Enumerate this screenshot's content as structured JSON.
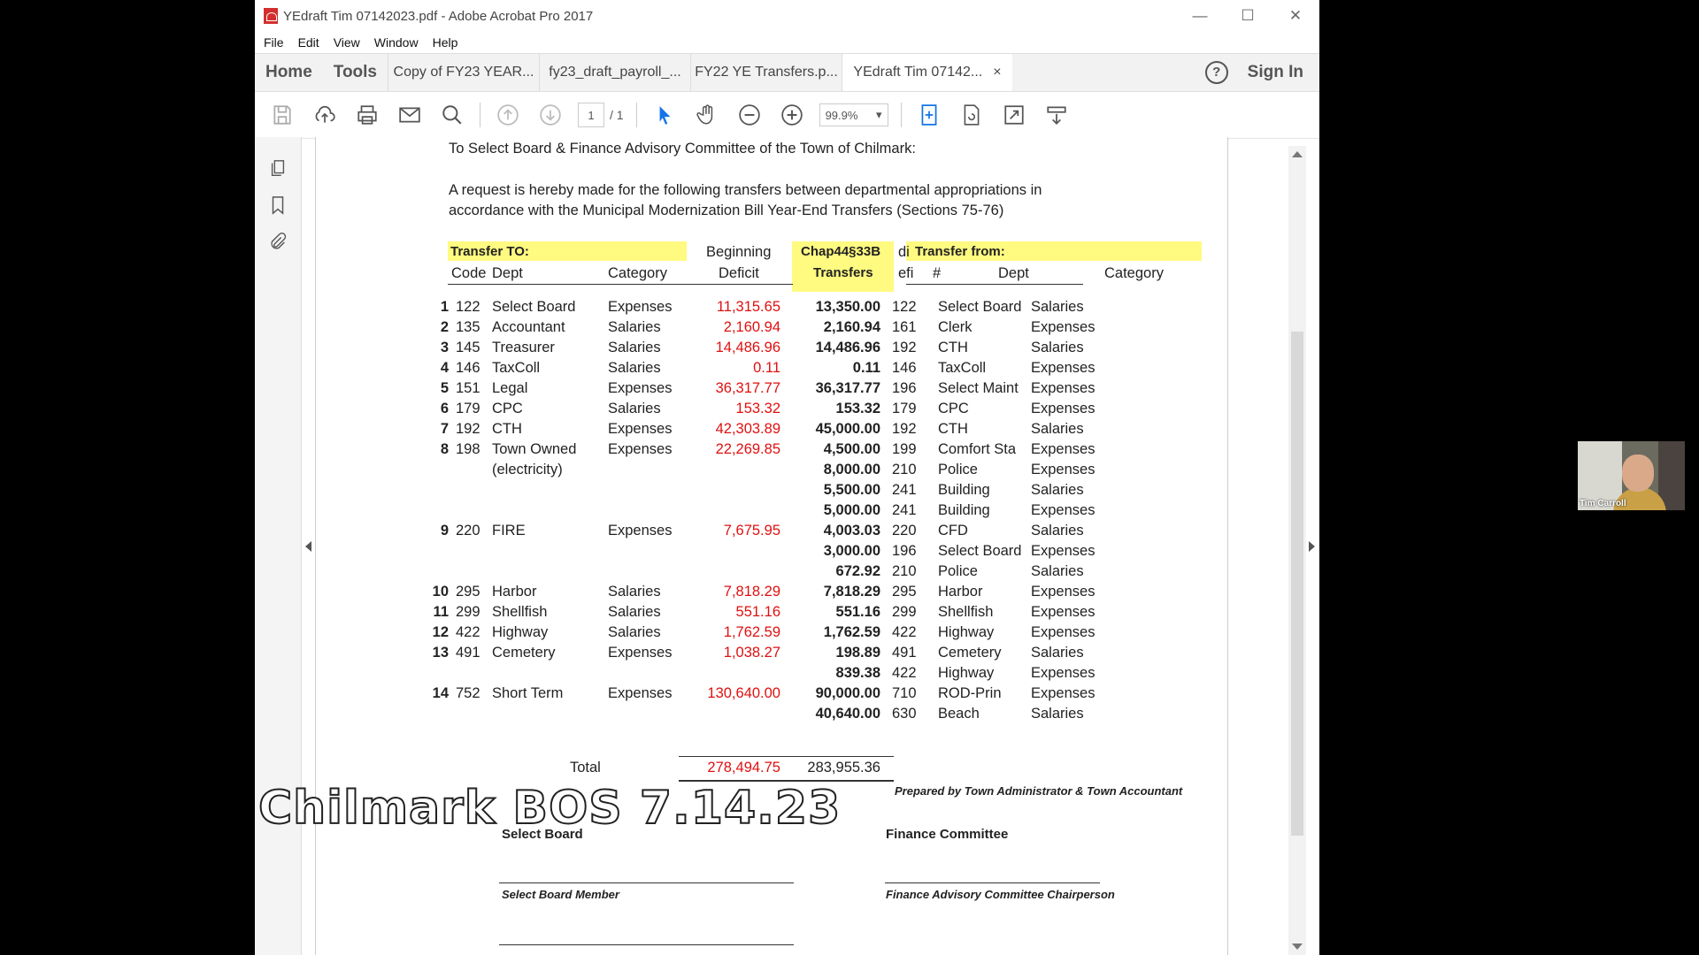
{
  "window": {
    "title": "YEdraft Tim 07142023.pdf - Adobe Acrobat Pro 2017",
    "minimize": "—",
    "maximize": "☐",
    "close": "✕"
  },
  "menu": [
    "File",
    "Edit",
    "View",
    "Window",
    "Help"
  ],
  "tabs": {
    "home": "Home",
    "tools": "Tools",
    "docs": [
      "Copy of FY23 YEAR...",
      "fy23_draft_payroll_...",
      "FY22 YE Transfers.p...",
      "YEdraft Tim 07142..."
    ],
    "close_glyph": "×",
    "help": "?",
    "sign_in": "Sign In"
  },
  "toolbar": {
    "page_current": "1",
    "page_total": "/ 1",
    "zoom": "99.9%",
    "icons": [
      "save-icon",
      "upload-icon",
      "print-icon",
      "email-icon",
      "search-icon",
      "prev-page-icon",
      "next-page-icon",
      "select-cursor-icon",
      "hand-icon",
      "zoom-out-icon",
      "zoom-in-icon",
      "fit-page-icon",
      "rotate-icon",
      "fullscreen-icon",
      "read-mode-icon"
    ]
  },
  "document": {
    "salutation": "To Select Board & Finance Advisory Committee of the Town of Chilmark:",
    "intro_1": "A request is hereby made for the following transfers between departmental appropriations in",
    "intro_2": "accordance with the Municipal Modernization Bill Year-End Transfers (Sections 75-76)",
    "headers": {
      "transfer_to": "Transfer TO:",
      "beginning": "Beginning",
      "chap": "Chap44§33B",
      "di": "di",
      "transfer_from": "Transfer from:",
      "code": "Code",
      "dept": "Dept",
      "category": "Category",
      "deficit": "Deficit",
      "transfers": "Transfers",
      "efi": "efi",
      "num": "#",
      "dept2": "Dept",
      "category2": "Category"
    },
    "rows": [
      {
        "n": "1",
        "code": "122",
        "dept": "Select Board",
        "cat": "Expenses",
        "deficit": "11,315.65",
        "transfer": "13,350.00",
        "fnum": "122",
        "fdept": "Select Board",
        "fcat": "Salaries"
      },
      {
        "n": "2",
        "code": "135",
        "dept": "Accountant",
        "cat": "Salaries",
        "deficit": "2,160.94",
        "transfer": "2,160.94",
        "fnum": "161",
        "fdept": "Clerk",
        "fcat": "Expenses"
      },
      {
        "n": "3",
        "code": "145",
        "dept": "Treasurer",
        "cat": "Salaries",
        "deficit": "14,486.96",
        "transfer": "14,486.96",
        "fnum": "192",
        "fdept": "CTH",
        "fcat": "Salaries"
      },
      {
        "n": "4",
        "code": "146",
        "dept": "TaxColl",
        "cat": "Salaries",
        "deficit": "0.11",
        "transfer": "0.11",
        "fnum": "146",
        "fdept": "TaxColl",
        "fcat": "Expenses"
      },
      {
        "n": "5",
        "code": "151",
        "dept": "Legal",
        "cat": "Expenses",
        "deficit": "36,317.77",
        "transfer": "36,317.77",
        "fnum": "196",
        "fdept": "Select Maint",
        "fcat": "Expenses"
      },
      {
        "n": "6",
        "code": "179",
        "dept": "CPC",
        "cat": "Salaries",
        "deficit": "153.32",
        "transfer": "153.32",
        "fnum": "179",
        "fdept": "CPC",
        "fcat": "Expenses"
      },
      {
        "n": "7",
        "code": "192",
        "dept": "CTH",
        "cat": "Expenses",
        "deficit": "42,303.89",
        "transfer": "45,000.00",
        "fnum": "192",
        "fdept": "CTH",
        "fcat": "Salaries"
      },
      {
        "n": "8",
        "code": "198",
        "dept": "Town Owned",
        "cat": "Expenses",
        "deficit": "22,269.85",
        "transfer": "4,500.00",
        "fnum": "199",
        "fdept": "Comfort Sta",
        "fcat": "Expenses"
      },
      {
        "n": "",
        "code": "",
        "dept": "(electricity)",
        "cat": "",
        "deficit": "",
        "transfer": "8,000.00",
        "fnum": "210",
        "fdept": "Police",
        "fcat": "Expenses"
      },
      {
        "n": "",
        "code": "",
        "dept": "",
        "cat": "",
        "deficit": "",
        "transfer": "5,500.00",
        "fnum": "241",
        "fdept": "Building",
        "fcat": "Salaries"
      },
      {
        "n": "",
        "code": "",
        "dept": "",
        "cat": "",
        "deficit": "",
        "transfer": "5,000.00",
        "fnum": "241",
        "fdept": "Building",
        "fcat": "Expenses"
      },
      {
        "n": "9",
        "code": "220",
        "dept": "FIRE",
        "cat": "Expenses",
        "deficit": "7,675.95",
        "transfer": "4,003.03",
        "fnum": "220",
        "fdept": "CFD",
        "fcat": "Salaries"
      },
      {
        "n": "",
        "code": "",
        "dept": "",
        "cat": "",
        "deficit": "",
        "transfer": "3,000.00",
        "fnum": "196",
        "fdept": "Select Board",
        "fcat": "Expenses"
      },
      {
        "n": "",
        "code": "",
        "dept": "",
        "cat": "",
        "deficit": "",
        "transfer": "672.92",
        "fnum": "210",
        "fdept": "Police",
        "fcat": "Salaries"
      },
      {
        "n": "10",
        "code": "295",
        "dept": "Harbor",
        "cat": "Salaries",
        "deficit": "7,818.29",
        "transfer": "7,818.29",
        "fnum": "295",
        "fdept": "Harbor",
        "fcat": "Expenses"
      },
      {
        "n": "11",
        "code": "299",
        "dept": "Shellfish",
        "cat": "Salaries",
        "deficit": "551.16",
        "transfer": "551.16",
        "fnum": "299",
        "fdept": "Shellfish",
        "fcat": "Expenses"
      },
      {
        "n": "12",
        "code": "422",
        "dept": "Highway",
        "cat": "Salaries",
        "deficit": "1,762.59",
        "transfer": "1,762.59",
        "fnum": "422",
        "fdept": "Highway",
        "fcat": "Expenses"
      },
      {
        "n": "13",
        "code": "491",
        "dept": "Cemetery",
        "cat": "Expenses",
        "deficit": "1,038.27",
        "transfer": "198.89",
        "fnum": "491",
        "fdept": "Cemetery",
        "fcat": "Salaries"
      },
      {
        "n": "",
        "code": "",
        "dept": "",
        "cat": "",
        "deficit": "",
        "transfer": "839.38",
        "fnum": "422",
        "fdept": "Highway",
        "fcat": "Expenses"
      },
      {
        "n": "14",
        "code": "752",
        "dept": "Short Term",
        "cat": "Expenses",
        "deficit": "130,640.00",
        "transfer": "90,000.00",
        "fnum": "710",
        "fdept": "ROD-Prin",
        "fcat": "Expenses"
      },
      {
        "n": "",
        "code": "",
        "dept": "",
        "cat": "",
        "deficit": "",
        "transfer": "40,640.00",
        "fnum": "630",
        "fdept": "Beach",
        "fcat": "Salaries"
      }
    ],
    "total_label": "Total",
    "total_deficit": "278,494.75",
    "total_transfers": "283,955.36",
    "prepared_by": "Prepared by Town Administrator & Town Accountant",
    "select_board": "Select Board",
    "finance_committee": "Finance Committee",
    "select_board_member": "Select Board Member",
    "finance_chair": "Finance Advisory Committee Chairperson"
  },
  "overlay": {
    "caption": "Chilmark BOS 7.14.23"
  },
  "video": {
    "participant": "Tim Carroll"
  },
  "colors": {
    "deficit_red": "#e01010",
    "highlight": "#fffa80",
    "acrobat_blue": "#1473e6"
  }
}
